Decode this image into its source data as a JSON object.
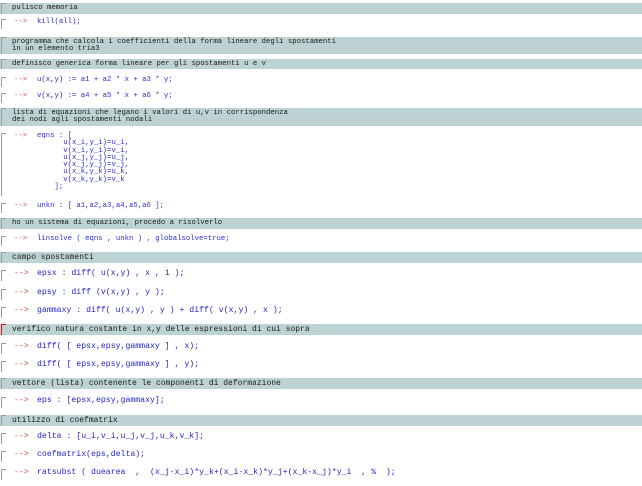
{
  "prompt_symbol": "-->",
  "cells": [
    {
      "type": "text",
      "text": "pulisco memoria"
    },
    {
      "type": "input",
      "code": "kill(all);"
    },
    {
      "type": "text",
      "text": "programma che calcola i coefficienti della forma lineare degli spostamenti\nin un elemento tria3"
    },
    {
      "type": "text",
      "text": "definisco generica forma lineare per gli spostamenti u e v"
    },
    {
      "type": "input",
      "code": "u(x,y) := a1 + a2 * x + a3 * y;"
    },
    {
      "type": "input",
      "code": "v(x,y) := a4 + a5 * x + a6 * y;"
    },
    {
      "type": "text",
      "text": "lista di equazioni che legano i valori di u,v in corrispondenza\ndei nodi agli spostamenti nodali"
    },
    {
      "type": "input",
      "code": "eqns : [\n      u(x_i,y_i)=u_i,\n      v(x_i,y_i)=v_i,\n      u(x_j,y_j)=u_j,\n      v(x_j,y_j)=v_j,\n      u(x_k,y_k)=u_k,\n      v(x_k,y_k)=v_k\n    ];"
    },
    {
      "type": "input",
      "code": "unkn : [ a1,a2,a3,a4,a5,a6 ];"
    },
    {
      "type": "text",
      "text": "ho un sistema di equazioni, procedo a risolverlo"
    },
    {
      "type": "input",
      "code": "linsolve ( eqns , unkn ) , globalsolve=true;"
    },
    {
      "type": "text",
      "text": "campo spostamenti"
    },
    {
      "type": "input",
      "code": "epsx : diff( u(x,y) , x , 1 );"
    },
    {
      "type": "input",
      "code": "epsy : diff (v(x,y) , y );"
    },
    {
      "type": "input",
      "code": "gammaxy : diff( u(x,y) , y ) + diff( v(x,y) , x );"
    },
    {
      "type": "text",
      "text": "verifico natura costante in x,y delle espressioni di cui sopra"
    },
    {
      "type": "input",
      "code": "diff( [ epsx,epsy,gammaxy ] , x);"
    },
    {
      "type": "input",
      "code": "diff( [ epsx,epsy,gammaxy ] , y);"
    },
    {
      "type": "text",
      "text": "vettore (lista) contenente le componenti di deformazione"
    },
    {
      "type": "input",
      "code": "eps : [epsx,epsy,gammaxy];"
    },
    {
      "type": "text",
      "text": "utilizzo di coefmatrix"
    },
    {
      "type": "input",
      "code": "delta : [u_i,v_i,u_j,v_j,u_k,v_k];"
    },
    {
      "type": "input",
      "code": "coefmatrix(eps,delta);"
    },
    {
      "type": "input",
      "code": "ratsubst ( duearea  ,  (x_j-x_i)*y_k+(x_i-x_k)*y_j+(x_k-x_j)*y_i  , %  );"
    }
  ]
}
